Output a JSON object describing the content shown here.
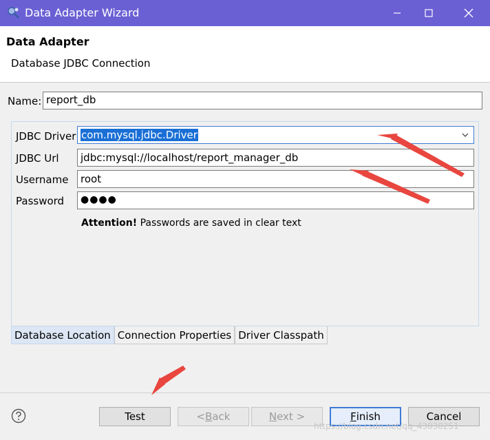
{
  "window": {
    "title": "Data Adapter Wizard",
    "minimize": "—",
    "maximize": "☐",
    "close": "✕"
  },
  "header": {
    "title": "Data Adapter",
    "subtitle": "Database JDBC Connection"
  },
  "name_field": {
    "label": "Name:",
    "value": "report_db"
  },
  "connection": {
    "driver_label": "JDBC Driver",
    "driver_value": "com.mysql.jdbc.Driver",
    "url_label": "JDBC Url",
    "url_value": "jdbc:mysql://localhost/report_manager_db",
    "username_label": "Username",
    "username_value": "root",
    "password_label": "Password",
    "password_value": "●●●●",
    "attention_bold": "Attention!",
    "attention_text": " Passwords are saved in clear text"
  },
  "tabs": [
    {
      "label": "Database Location"
    },
    {
      "label": "Connection Properties"
    },
    {
      "label": "Driver Classpath"
    }
  ],
  "buttons": {
    "test": "Test",
    "back_prefix": "< ",
    "back_mnemonic": "B",
    "back_rest": "ack",
    "next_mnemonic": "N",
    "next_rest": "ext >",
    "finish_mnemonic": "F",
    "finish_rest": "inish",
    "cancel": "Cancel"
  },
  "watermark": "https://blog.csdn.net/qq_43030251",
  "colors": {
    "titlebar": "#6a60d4",
    "selection": "#1a6fd6",
    "annotation_arrow": "#e8463f"
  }
}
